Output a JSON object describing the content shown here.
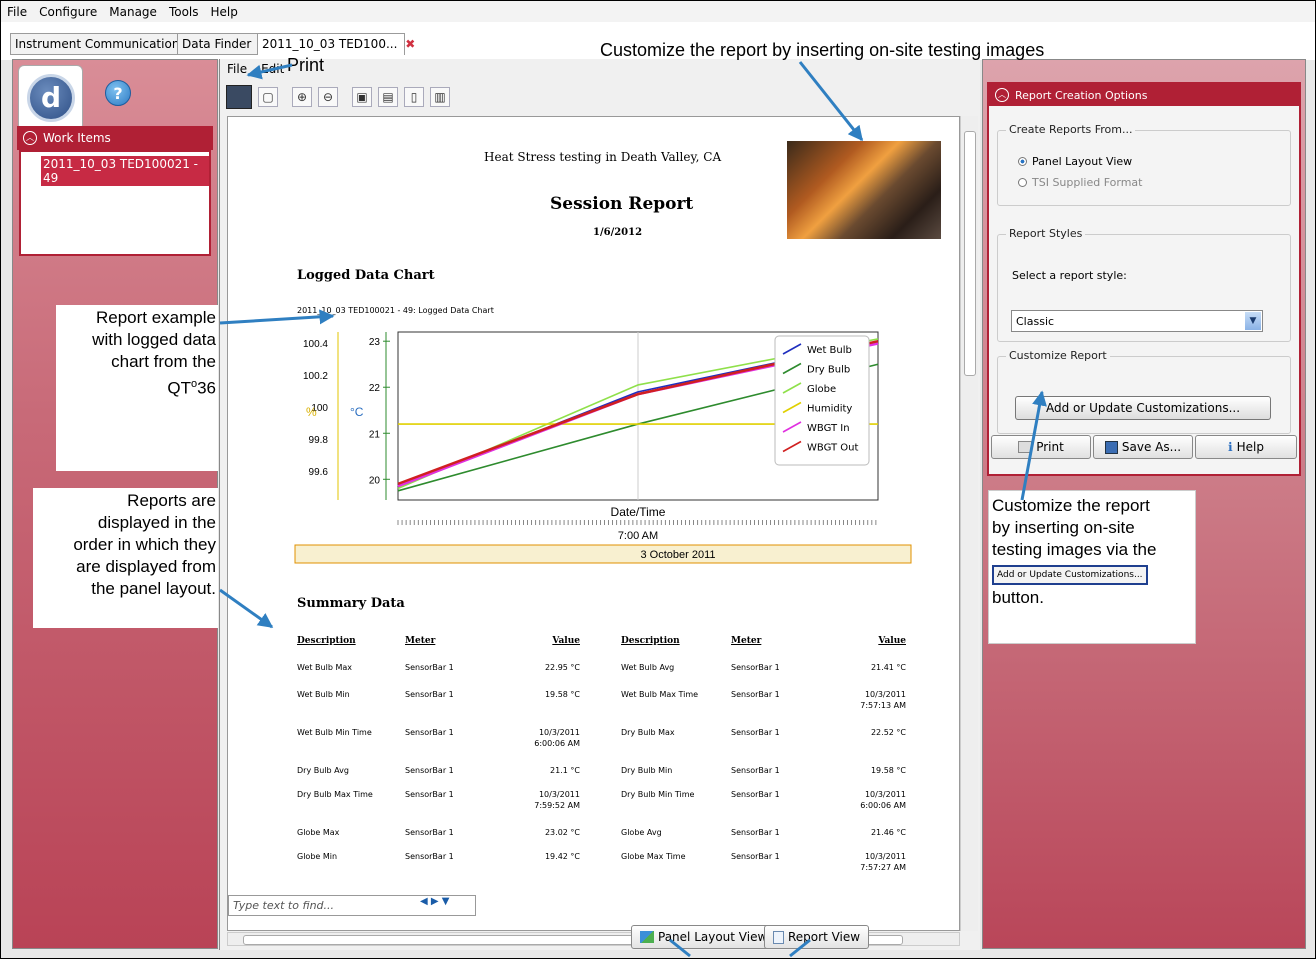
{
  "menubar": [
    "File",
    "Configure",
    "Manage",
    "Tools",
    "Help"
  ],
  "tabs": [
    "Instrument Communications",
    "Data Finder",
    "2011_10_03 TED100..."
  ],
  "work_items": {
    "title": "Work Items",
    "item": "2011_10_03 TED100021 - 49"
  },
  "center_menu": [
    "File",
    "Edit"
  ],
  "toolbar_icons": [
    "print-icon",
    "copy-icon",
    "zoom-in-icon",
    "zoom-out-icon",
    "fit-page-icon",
    "fit-width-icon",
    "single-page-icon",
    "two-page-icon"
  ],
  "report": {
    "heading": "Heat Stress testing in Death Valley, CA",
    "title": "Session Report",
    "date": "1/6/2012",
    "section_chart": "Logged Data Chart",
    "chart_caption": "2011_10_03 TED100021 - 49: Logged Data Chart",
    "section_summary": "Summary Data"
  },
  "chart_data": {
    "type": "line",
    "xlabel": "Date/Time",
    "x_tick": "7:00 AM",
    "x_date": "3 October 2011",
    "ylabel_left": "%",
    "ylabel_right": "°C",
    "left_ticks": [
      "100.4",
      "100.2",
      "100",
      "99.8",
      "99.6"
    ],
    "right_ticks": [
      "23",
      "22",
      "21",
      "20"
    ],
    "ylim_c": [
      19.55,
      23.2
    ],
    "x": [
      0,
      1,
      2
    ],
    "series": [
      {
        "name": "Wet Bulb",
        "color": "#1f2fbf",
        "values": [
          19.85,
          21.9,
          23.0
        ]
      },
      {
        "name": "Dry Bulb",
        "color": "#2e8b2e",
        "values": [
          19.75,
          21.2,
          22.5
        ]
      },
      {
        "name": "Globe",
        "color": "#8fe04a",
        "values": [
          19.8,
          22.05,
          23.05
        ]
      },
      {
        "name": "Humidity",
        "color": "#e0d000",
        "values": [
          21.2,
          21.2,
          21.2
        ]
      },
      {
        "name": "WBGT In",
        "color": "#e030e0",
        "values": [
          19.85,
          21.85,
          22.95
        ]
      },
      {
        "name": "WBGT Out",
        "color": "#d02020",
        "values": [
          19.9,
          21.85,
          23.0
        ]
      }
    ]
  },
  "summary": {
    "headers": [
      "Description",
      "Meter",
      "Value",
      "Description",
      "Meter",
      "Value"
    ],
    "rows": [
      [
        "Wet Bulb Max",
        "SensorBar 1",
        "22.95 °C",
        "Wet Bulb Avg",
        "SensorBar 1",
        "21.41 °C"
      ],
      [
        "Wet Bulb Min",
        "SensorBar 1",
        "19.58 °C",
        "Wet Bulb Max Time",
        "SensorBar 1",
        "10/3/2011\n7:57:13 AM"
      ],
      [
        "Wet Bulb Min Time",
        "SensorBar 1",
        "10/3/2011\n6:00:06 AM",
        "Dry Bulb Max",
        "SensorBar 1",
        "22.52 °C"
      ],
      [
        "Dry Bulb Avg",
        "SensorBar 1",
        "21.1 °C",
        "Dry Bulb Min",
        "SensorBar 1",
        "19.58 °C"
      ],
      [
        "Dry Bulb Max Time",
        "SensorBar 1",
        "10/3/2011\n7:59:52 AM",
        "Dry Bulb Min Time",
        "SensorBar 1",
        "10/3/2011\n6:00:06 AM"
      ],
      [
        "Globe Max",
        "SensorBar 1",
        "23.02 °C",
        "Globe Avg",
        "SensorBar 1",
        "21.46 °C"
      ],
      [
        "Globe Min",
        "SensorBar 1",
        "19.42 °C",
        "Globe Max Time",
        "SensorBar 1",
        "10/3/2011\n7:57:27 AM"
      ]
    ]
  },
  "find": {
    "placeholder": "Type text to find..."
  },
  "bottom": {
    "panel_layout": "Panel Layout View",
    "report_view": "Report View"
  },
  "right": {
    "title": "Report Creation Options",
    "create_from": "Create Reports From...",
    "opt_panel": "Panel Layout View",
    "opt_tsi": "TSI Supplied Format",
    "styles": "Report Styles",
    "select_label": "Select a report style:",
    "select_value": "Classic",
    "customize": "Customize Report",
    "add_update": "Add or Update Customizations...",
    "print": "Print",
    "save_as": "Save As...",
    "help": "Help"
  },
  "callouts": {
    "print": "Print",
    "top": "Customize the report by inserting on-site testing images",
    "report_example": [
      "Report example",
      "with logged data",
      "chart from the",
      "QT"
    ],
    "qt_sup": "o",
    "qt_suffix": "36",
    "reports_order": [
      "Reports are",
      "displayed in the",
      "order in which they",
      "are displayed from",
      "the panel layout."
    ],
    "right_lines": [
      "Customize the report",
      "by inserting on-site",
      "testing images via the"
    ],
    "right_button": "Add or Update Customizations...",
    "right_tail": "button."
  },
  "colors": {
    "brand": "#b02035",
    "arrow": "#2f7fc1"
  }
}
